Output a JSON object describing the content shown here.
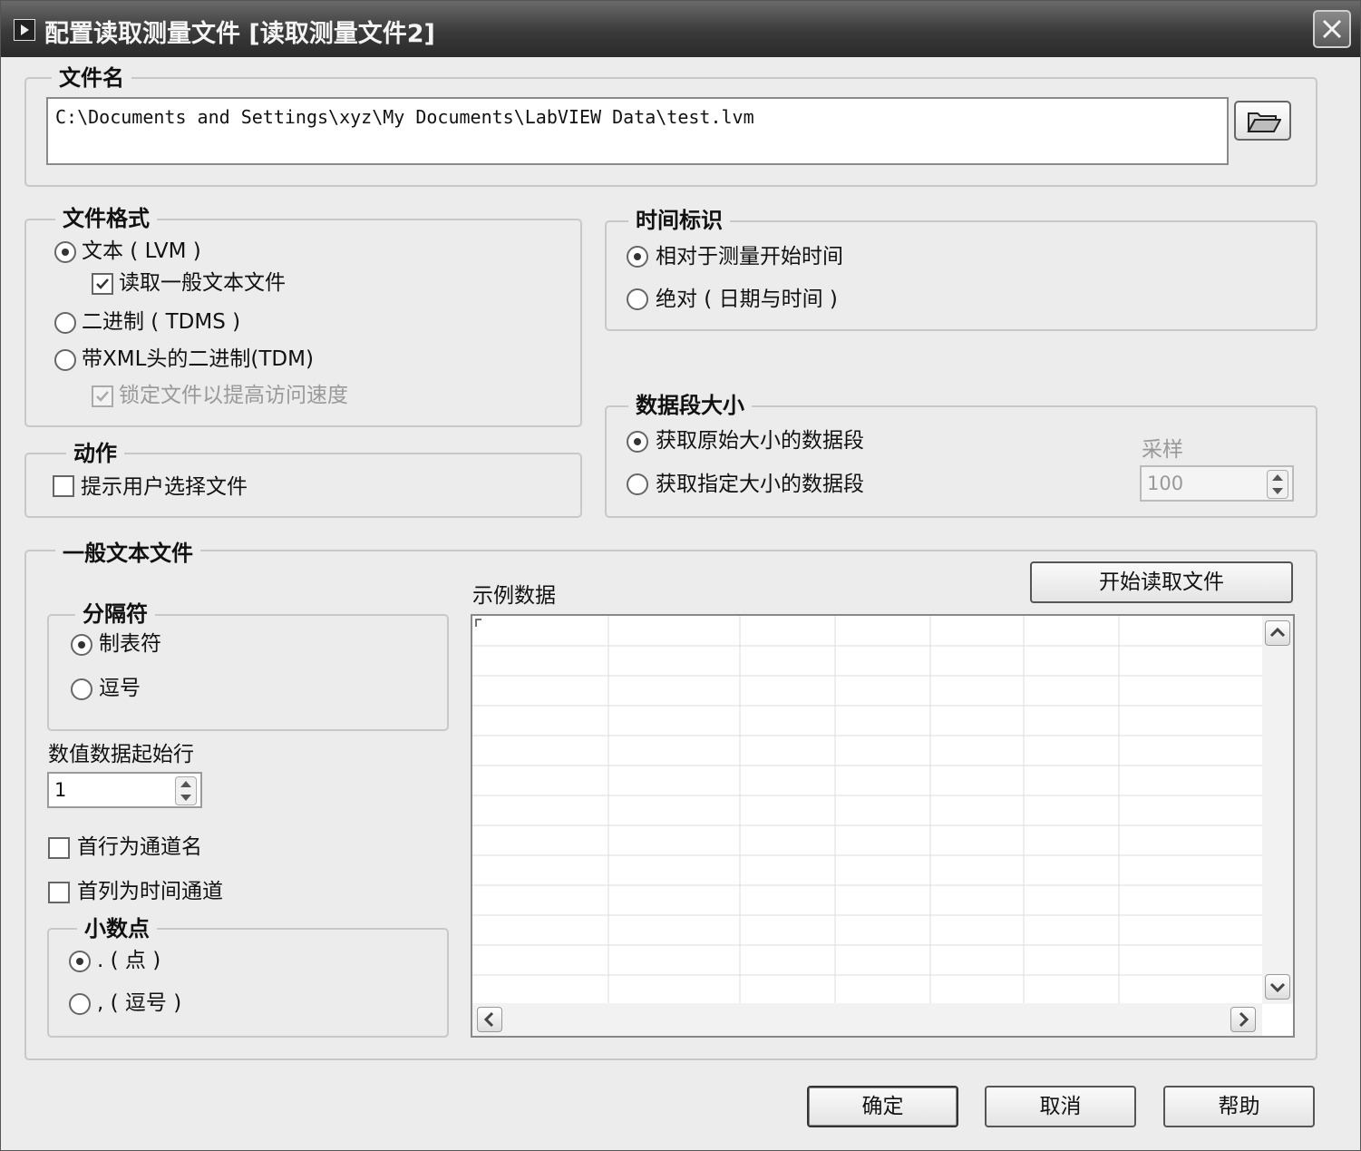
{
  "window": {
    "title": "配置读取测量文件 [读取测量文件2]"
  },
  "file_name": {
    "legend": "文件名",
    "path": "C:\\Documents and Settings\\xyz\\My Documents\\LabVIEW Data\\test.lvm"
  },
  "file_format": {
    "legend": "文件格式",
    "options": [
      {
        "label": "文本 ( LVM )",
        "selected": true
      },
      {
        "label": "二进制 ( TDMS )",
        "selected": false
      },
      {
        "label": "带XML头的二进制(TDM)",
        "selected": false
      }
    ],
    "read_generic_text": {
      "label": "读取一般文本文件",
      "checked": true
    },
    "lock_file": {
      "label": "锁定文件以提高访问速度",
      "checked": true,
      "disabled": true
    }
  },
  "action": {
    "legend": "动作",
    "prompt_user": {
      "label": "提示用户选择文件",
      "checked": false
    }
  },
  "timestamp": {
    "legend": "时间标识",
    "options": [
      {
        "label": "相对于测量开始时间",
        "selected": true
      },
      {
        "label": "绝对 ( 日期与时间 )",
        "selected": false
      }
    ]
  },
  "segment_size": {
    "legend": "数据段大小",
    "options": [
      {
        "label": "获取原始大小的数据段",
        "selected": true
      },
      {
        "label": "获取指定大小的数据段",
        "selected": false
      }
    ],
    "samples_label": "采样",
    "samples_value": "100"
  },
  "generic_text": {
    "legend": "一般文本文件",
    "delimiter": {
      "legend": "分隔符",
      "options": [
        {
          "label": "制表符",
          "selected": true
        },
        {
          "label": "逗号",
          "selected": false
        }
      ]
    },
    "start_row_label": "数值数据起始行",
    "start_row_value": "1",
    "first_row_names": {
      "label": "首行为通道名",
      "checked": false
    },
    "first_col_time": {
      "label": "首列为时间通道",
      "checked": false
    },
    "decimal": {
      "legend": "小数点",
      "options": [
        {
          "label": ". ( 点 )",
          "selected": true
        },
        {
          "label": ", ( 逗号 )",
          "selected": false
        }
      ]
    },
    "sample_data_label": "示例数据",
    "start_read_button": "开始读取文件"
  },
  "buttons": {
    "ok": "确定",
    "cancel": "取消",
    "help": "帮助"
  }
}
